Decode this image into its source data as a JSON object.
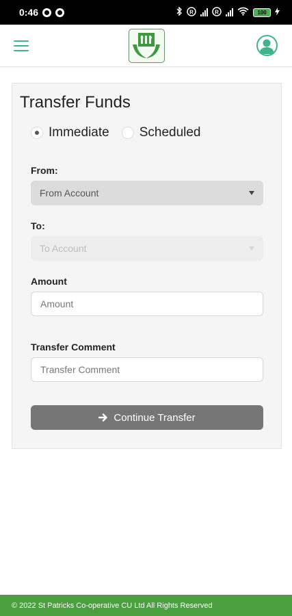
{
  "status_bar": {
    "time": "0:46",
    "battery": "100",
    "r_badge": "R"
  },
  "header": {
    "menu_icon": "hamburger-icon",
    "logo_icon": "credit-union-logo",
    "profile_icon": "user-avatar-icon",
    "accent_color": "#3fb48c"
  },
  "form": {
    "title": "Transfer Funds",
    "transfer_type": {
      "options": [
        "Immediate",
        "Scheduled"
      ],
      "selected": "Immediate"
    },
    "from": {
      "label": "From:",
      "placeholder": "From Account"
    },
    "to": {
      "label": "To:",
      "placeholder": "To Account",
      "disabled": true
    },
    "amount": {
      "label": "Amount",
      "placeholder": "Amount",
      "value": ""
    },
    "comment": {
      "label": "Transfer Comment",
      "placeholder": "Transfer Comment",
      "value": ""
    },
    "submit_label": "Continue Transfer",
    "submit_icon": "arrow-right-icon"
  },
  "footer": {
    "text": "© 2022 St Patricks Co-operative CU Ltd All Rights Reserved",
    "color": "#4a9f3e"
  }
}
